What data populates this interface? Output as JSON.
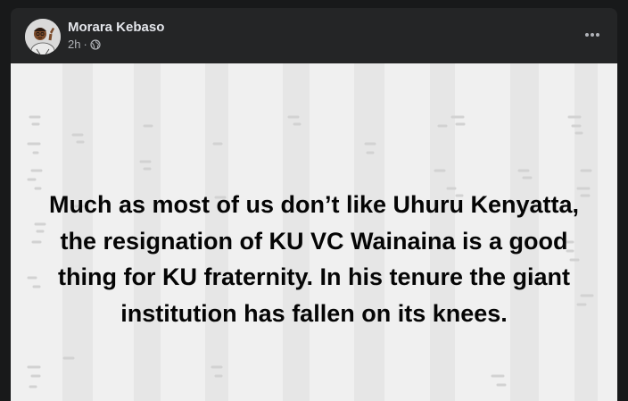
{
  "post": {
    "author": "Morara Kebaso",
    "time": "2h",
    "separator": "·",
    "privacy_icon": "globe-icon",
    "menu_icon": "more-options-icon",
    "text": "Much as most of us don’t like Uhuru Kenyatta, the resignation of KU VC Wainaina is a good thing for KU fraternity. In his tenure the giant institution has fallen on its knees."
  },
  "colors": {
    "page_bg": "#18191a",
    "card_bg": "#242526",
    "author_text": "#e4e6eb",
    "meta_text": "#b0b3b8",
    "post_bg": "#f0f0f0",
    "post_text": "#050505"
  }
}
